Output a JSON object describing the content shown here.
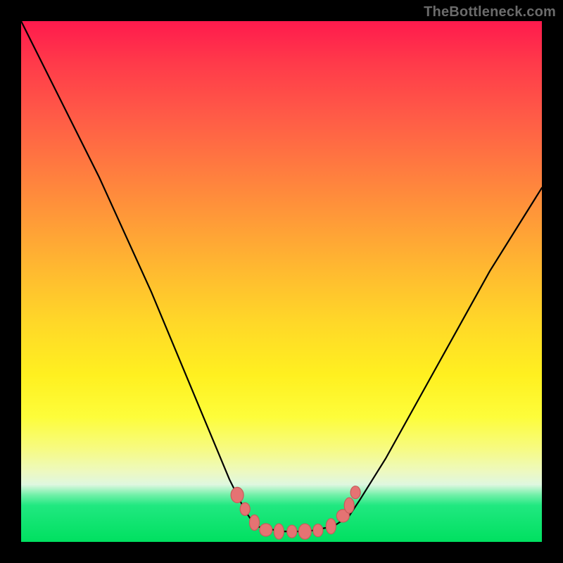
{
  "watermark": "TheBottleneck.com",
  "colors": {
    "frame": "#000000",
    "gradient_top": "#ff1a4d",
    "gradient_bottom": "#00e060",
    "curve_stroke": "#000000",
    "marker_fill": "#e57373",
    "marker_stroke": "#c95a5a"
  },
  "chart_data": {
    "type": "line",
    "title": "",
    "xlabel": "",
    "ylabel": "",
    "xlim": [
      0,
      1
    ],
    "ylim": [
      0,
      1
    ],
    "note": "No axis ticks or numeric labels are rendered. X is normalized horizontal position (0=left,1=right); Y is normalized height (0=bottom,1=top). Values estimated from pixels.",
    "series": [
      {
        "name": "bottleneck-curve",
        "x": [
          0.0,
          0.05,
          0.1,
          0.15,
          0.2,
          0.25,
          0.3,
          0.35,
          0.4,
          0.43,
          0.45,
          0.5,
          0.55,
          0.6,
          0.63,
          0.65,
          0.7,
          0.75,
          0.8,
          0.85,
          0.9,
          0.95,
          1.0
        ],
        "y": [
          1.0,
          0.9,
          0.8,
          0.7,
          0.59,
          0.48,
          0.36,
          0.24,
          0.12,
          0.06,
          0.03,
          0.02,
          0.02,
          0.03,
          0.05,
          0.08,
          0.16,
          0.25,
          0.34,
          0.43,
          0.52,
          0.6,
          0.68
        ]
      }
    ],
    "markers": {
      "name": "highlight-points",
      "note": "Salmon-colored dots clustered near the curve minimum.",
      "points": [
        {
          "x": 0.415,
          "y": 0.09
        },
        {
          "x": 0.43,
          "y": 0.063
        },
        {
          "x": 0.448,
          "y": 0.037
        },
        {
          "x": 0.47,
          "y": 0.023
        },
        {
          "x": 0.495,
          "y": 0.02
        },
        {
          "x": 0.52,
          "y": 0.02
        },
        {
          "x": 0.545,
          "y": 0.02
        },
        {
          "x": 0.57,
          "y": 0.022
        },
        {
          "x": 0.595,
          "y": 0.03
        },
        {
          "x": 0.618,
          "y": 0.05
        },
        {
          "x": 0.63,
          "y": 0.07
        },
        {
          "x": 0.642,
          "y": 0.095
        }
      ]
    }
  }
}
